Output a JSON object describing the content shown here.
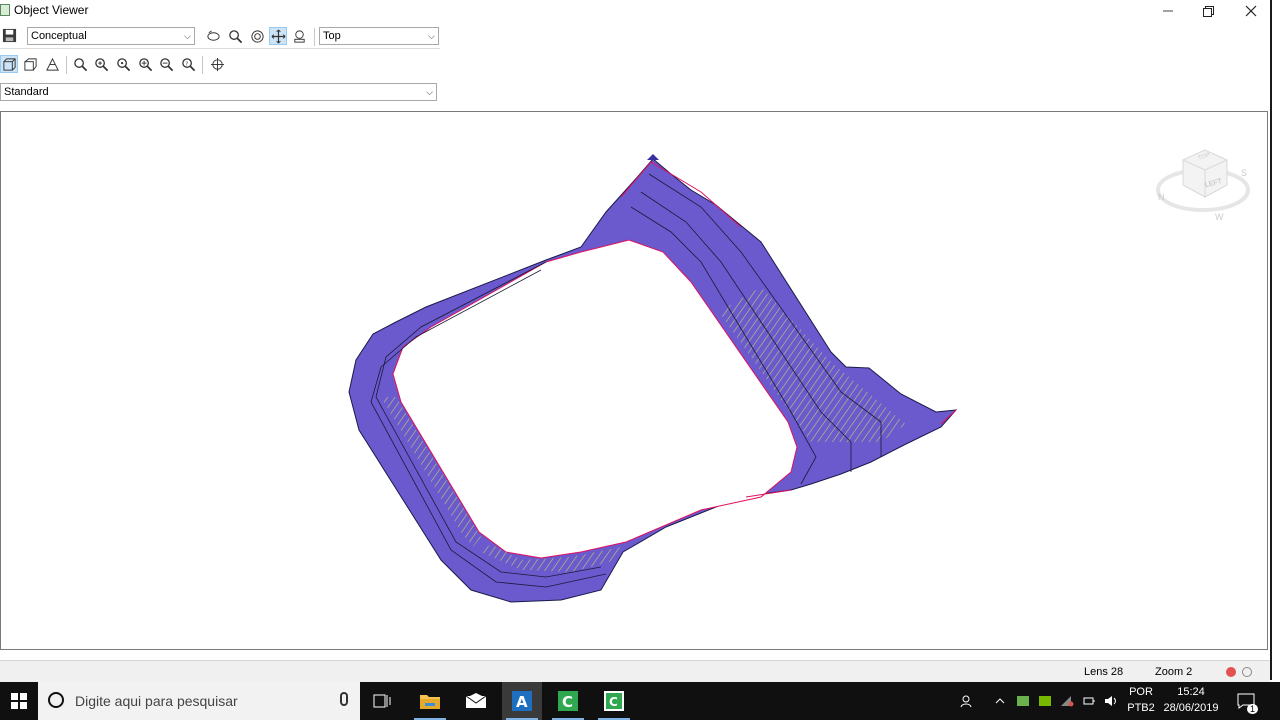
{
  "window": {
    "title": "Object Viewer",
    "minimize_icon": "minimize-icon",
    "restore_icon": "restore-icon",
    "close_icon": "close-icon"
  },
  "toolbar": {
    "visual_style": "Conceptual",
    "view_direction": "Top",
    "view_style": "Standard"
  },
  "viewcube": {
    "face_label": "LEFT",
    "top_label": "TOP",
    "compass": [
      "N",
      "S",
      "W"
    ]
  },
  "status": {
    "lens": "Lens 28",
    "zoom": "Zoom 2"
  },
  "taskbar": {
    "search_placeholder": "Digite aqui para pesquisar",
    "language": "POR",
    "keyboard": "PTB2",
    "time": "15:24",
    "date": "28/06/2019",
    "notification_count": "1"
  },
  "colors": {
    "surface": "#6a5acd",
    "surface_dark": "#3a2f9e",
    "boundary": "#e0115f",
    "hatch": "#c8d86a"
  }
}
